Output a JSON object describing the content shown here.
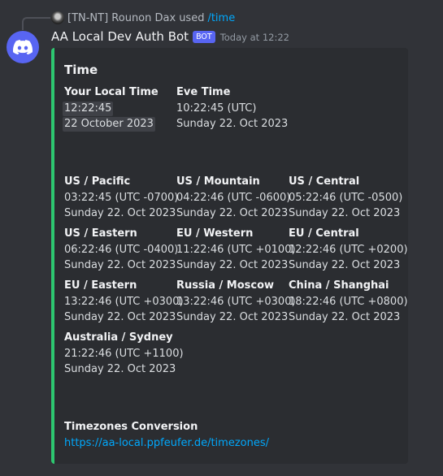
{
  "reply": {
    "user": "[TN-NT] Rounon Dax",
    "used_text": "used",
    "command": "/time"
  },
  "message": {
    "author": "AA Local Dev Auth Bot",
    "badge": "BOT",
    "timestamp": "Today at 12:22"
  },
  "embed": {
    "accent_color": "#2dc770",
    "title": "Time",
    "local_time": {
      "name": "Your Local Time",
      "time": "12:22:45",
      "date": "22 October 2023"
    },
    "eve_time": {
      "name": "Eve Time",
      "time": "10:22:45 (UTC)",
      "date": "Sunday 22. Oct 2023"
    },
    "zones": [
      {
        "name": "US / Pacific",
        "time": "03:22:45 (UTC -0700)",
        "date": "Sunday 22. Oct 2023"
      },
      {
        "name": "US / Mountain",
        "time": "04:22:46 (UTC -0600)",
        "date": "Sunday 22. Oct 2023"
      },
      {
        "name": "US / Central",
        "time": "05:22:46 (UTC -0500)",
        "date": "Sunday 22. Oct 2023"
      },
      {
        "name": "US / Eastern",
        "time": "06:22:46 (UTC -0400)",
        "date": "Sunday 22. Oct 2023"
      },
      {
        "name": "EU / Western",
        "time": "11:22:46 (UTC +0100)",
        "date": "Sunday 22. Oct 2023"
      },
      {
        "name": "EU / Central",
        "time": "12:22:46 (UTC +0200)",
        "date": "Sunday 22. Oct 2023"
      },
      {
        "name": "EU / Eastern",
        "time": "13:22:46 (UTC +0300)",
        "date": "Sunday 22. Oct 2023"
      },
      {
        "name": "Russia / Moscow",
        "time": "13:22:46 (UTC +0300)",
        "date": "Sunday 22. Oct 2023"
      },
      {
        "name": "China / Shanghai",
        "time": "18:22:46 (UTC +0800)",
        "date": "Sunday 22. Oct 2023"
      },
      {
        "name": "Australia / Sydney",
        "time": "21:22:46 (UTC +1100)",
        "date": "Sunday 22. Oct 2023"
      }
    ],
    "conversion": {
      "name": "Timezones Conversion",
      "url": "https://aa-local.ppfeufer.de/timezones/"
    }
  }
}
